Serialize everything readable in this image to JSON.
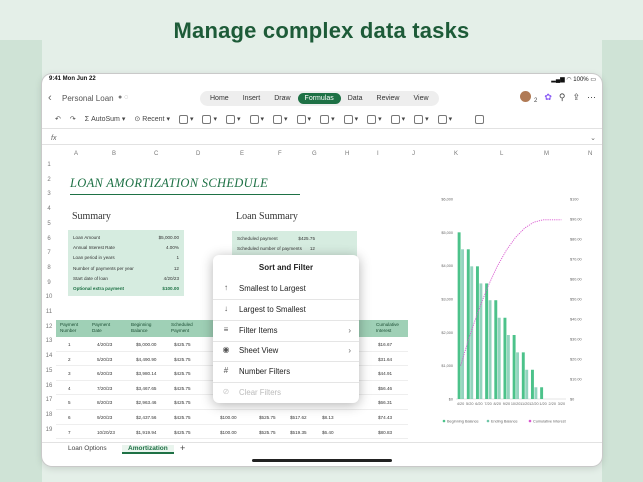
{
  "headline": "Manage complex data tasks",
  "status": {
    "time": "9:41  Mon Jun 22",
    "battery": "100%"
  },
  "doc": {
    "name": "Personal Loan",
    "back_icon": "chevron-left-icon"
  },
  "tabs": [
    "Home",
    "Insert",
    "Draw",
    "Formulas",
    "Data",
    "Review",
    "View"
  ],
  "active_tab": "Formulas",
  "collab_count": "2",
  "ribbon": {
    "autosum": "AutoSum",
    "recent": "Recent"
  },
  "formula_bar": {
    "fx": "fx"
  },
  "columns": [
    "A",
    "B",
    "C",
    "D",
    "E",
    "F",
    "G",
    "H",
    "I",
    "J",
    "K",
    "L",
    "M",
    "N"
  ],
  "rows": [
    "1",
    "2",
    "3",
    "4",
    "5",
    "6",
    "7",
    "8",
    "9",
    "10",
    "11",
    "12",
    "13",
    "14",
    "15",
    "16",
    "17",
    "18",
    "19"
  ],
  "sheet_title": "LOAN AMORTIZATION SCHEDULE",
  "summary": {
    "heading": "Summary",
    "items": [
      {
        "label": "Loan Amount",
        "value": "$5,000.00"
      },
      {
        "label": "Annual Interest Rate",
        "value": "4.00%"
      },
      {
        "label": "Loan period in years",
        "value": "1"
      },
      {
        "label": "Number of payments per year",
        "value": "12"
      },
      {
        "label": "Start date of loan",
        "value": "4/20/23"
      },
      {
        "label": "Optional extra payment",
        "value": "$100.00"
      }
    ]
  },
  "loan_summary": {
    "heading": "Loan Summary",
    "items": [
      {
        "label": "Scheduled payment",
        "value": "$425.75"
      },
      {
        "label": "Scheduled number of payments",
        "value": "12"
      }
    ]
  },
  "table": {
    "headers": [
      "Payment Number",
      "Payment Date",
      "Beginning Balance",
      "Scheduled Payment",
      "Cumulative Interest"
    ],
    "rows": [
      {
        "n": "1",
        "date": "4/20/23",
        "bal": "$5,000.00",
        "pay": "$425.75",
        "interest": "$16.67"
      },
      {
        "n": "2",
        "date": "5/20/23",
        "bal": "$4,490.90",
        "pay": "$425.75",
        "interest": "$31.64"
      },
      {
        "n": "3",
        "date": "6/20/23",
        "bal": "$3,980.14",
        "pay": "$425.75",
        "interest": "$44.91"
      },
      {
        "n": "4",
        "date": "7/20/23",
        "bal": "$3,467.65",
        "pay": "$425.75",
        "interest": "$56.46"
      },
      {
        "n": "5",
        "date": "8/20/23",
        "bal": "$2,963.46",
        "pay": "$425.75",
        "interest": "$66.31"
      },
      {
        "n": "6",
        "date": "9/20/23",
        "bal": "$2,437.56",
        "pay": "$425.75",
        "e": "$100.00",
        "f": "$525.75",
        "g": "$517.62",
        "h": "$8.13",
        "interest": "$74.43"
      },
      {
        "n": "7",
        "date": "10/20/23",
        "bal": "$1,919.94",
        "pay": "$425.75",
        "e": "$100.00",
        "f": "$525.75",
        "g": "$519.35",
        "h": "$6.40",
        "interest": "$80.83"
      }
    ]
  },
  "popup": {
    "title": "Sort and Filter",
    "items": [
      {
        "label": "Smallest to Largest",
        "icon": "arrow-up-icon"
      },
      {
        "label": "Largest to Smallest",
        "icon": "arrow-down-icon"
      },
      {
        "label": "Filter Items",
        "icon": "filter-icon"
      },
      {
        "label": "Sheet View",
        "icon": "eye-icon"
      },
      {
        "label": "Number Filters",
        "icon": "hash-icon"
      },
      {
        "label": "Clear Filters",
        "icon": "clear-filter-icon"
      }
    ]
  },
  "sheets": [
    "Loan Options",
    "Amortization"
  ],
  "active_sheet": "Amortization",
  "add_sheet": "+",
  "chart_data": {
    "type": "bar",
    "y_left_ticks": [
      "$0",
      "$1,000",
      "$2,000",
      "$3,000",
      "$4,000",
      "$5,000",
      "$6,000"
    ],
    "y_right_ticks": [
      "$0",
      "$10.00",
      "$20.00",
      "$30.00",
      "$40.00",
      "$50.00",
      "$60.00",
      "$70.00",
      "$80.00",
      "$90.00",
      "$100"
    ],
    "categories": [
      "4/20",
      "5/20",
      "6/20",
      "7/20",
      "8/20",
      "9/20",
      "10/20",
      "11/20",
      "12/20",
      "1/20",
      "2/20",
      "3/20"
    ],
    "series": [
      {
        "name": "Beginning Balance",
        "values": [
          5000,
          4490.9,
          3980.14,
          3467.65,
          2963.46,
          2437.56,
          1919.94,
          1399.2,
          877.2,
          352.1,
          0,
          0
        ]
      },
      {
        "name": "Ending Balance",
        "values": [
          4490.9,
          3980.14,
          3467.65,
          2963.46,
          2437.56,
          1919.94,
          1399.2,
          877.2,
          352.1,
          0,
          0,
          0
        ]
      },
      {
        "name": "Cumulative Interest",
        "values": [
          16.67,
          31.64,
          44.91,
          56.46,
          66.31,
          74.43,
          80.83,
          85.5,
          88.4,
          89.6,
          89.6,
          89.6
        ]
      }
    ],
    "colors": {
      "begin": "#4cc28a",
      "end": "#6fc6a8",
      "cum": "#d957d0"
    },
    "ylim_left": [
      0,
      6000
    ],
    "ylim_right": [
      0,
      100
    ],
    "legend": "bottom"
  }
}
